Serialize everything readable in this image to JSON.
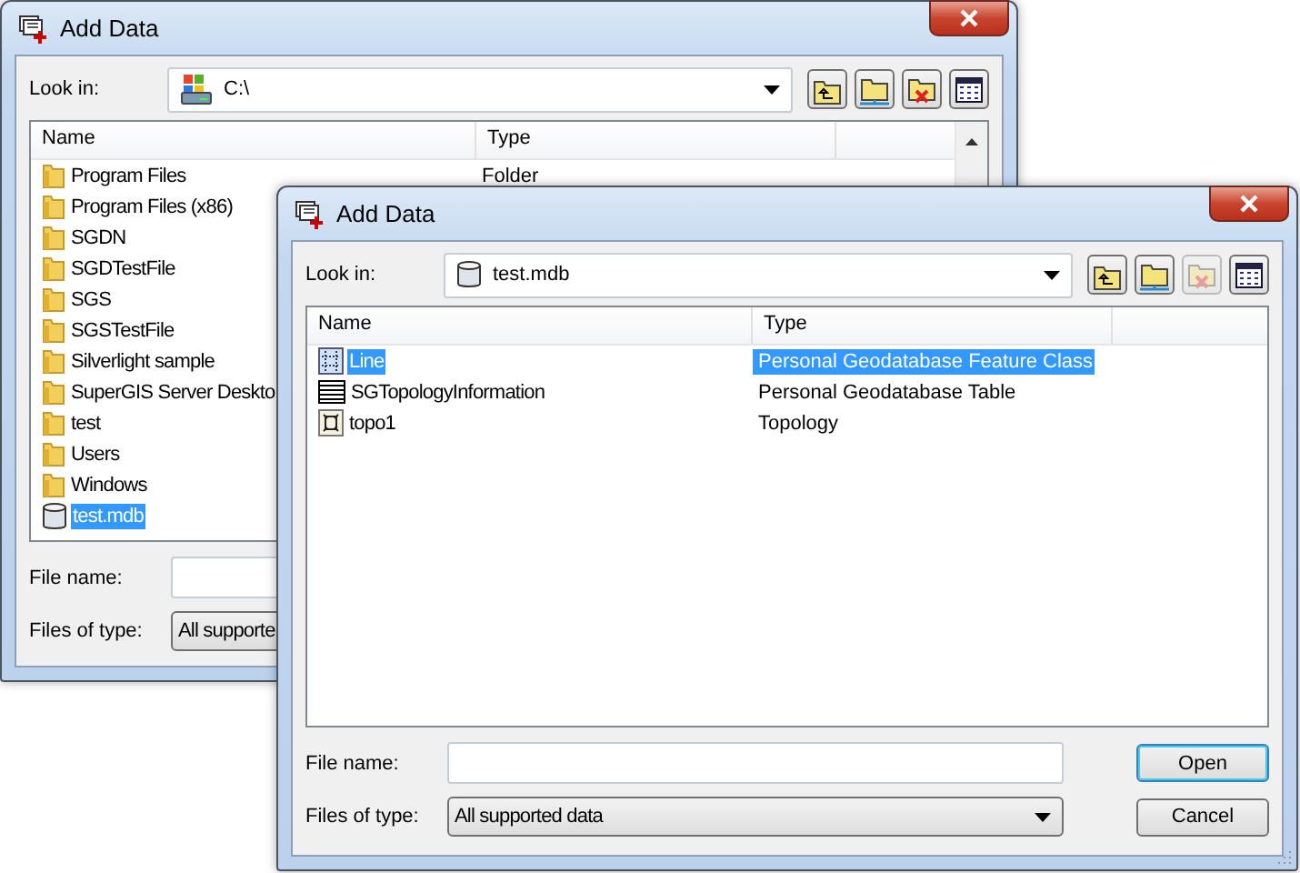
{
  "windows": [
    {
      "title": "Add Data",
      "look_in": {
        "label": "Look in:",
        "value": "C:\\",
        "kind": "drive"
      },
      "toolbar": [
        {
          "kind": "up",
          "disabled": false
        },
        {
          "kind": "connect",
          "disabled": false
        },
        {
          "kind": "disconnect",
          "disabled": false
        },
        {
          "kind": "options",
          "disabled": false
        }
      ],
      "columns": [
        "Name",
        "Type"
      ],
      "rows": [
        {
          "name": "Program Files",
          "type": "Folder",
          "kind": "folder",
          "selected": false
        },
        {
          "name": "Program Files (x86)",
          "kind": "folder",
          "selected": false
        },
        {
          "name": "SGDN",
          "kind": "folder",
          "selected": false
        },
        {
          "name": "SGDTestFile",
          "kind": "folder",
          "selected": false
        },
        {
          "name": "SGS",
          "kind": "folder",
          "selected": false
        },
        {
          "name": "SGSTestFile",
          "kind": "folder",
          "selected": false
        },
        {
          "name": "Silverlight sample",
          "kind": "folder",
          "selected": false
        },
        {
          "name": "SuperGIS Server Deskto",
          "kind": "folder",
          "selected": false
        },
        {
          "name": "test",
          "kind": "folder",
          "selected": false
        },
        {
          "name": "Users",
          "kind": "folder",
          "selected": false
        },
        {
          "name": "Windows",
          "kind": "folder",
          "selected": false
        },
        {
          "name": "test.mdb",
          "kind": "database",
          "selected": true
        }
      ],
      "file_name": {
        "label": "File name:"
      },
      "file_type": {
        "label": "Files of type:",
        "value": "All supporte"
      }
    },
    {
      "title": "Add Data",
      "look_in": {
        "label": "Look in:",
        "value": "test.mdb",
        "kind": "database"
      },
      "toolbar": [
        {
          "kind": "up",
          "disabled": false
        },
        {
          "kind": "connect",
          "disabled": false
        },
        {
          "kind": "disconnect",
          "disabled": true
        },
        {
          "kind": "options",
          "disabled": false
        }
      ],
      "columns": [
        "Name",
        "Type"
      ],
      "rows": [
        {
          "name": "Line",
          "type": "Personal Geodatabase Feature Class",
          "kind": "feature_class",
          "selected": true
        },
        {
          "name": "SGTopologyInformation",
          "type": "Personal Geodatabase Table",
          "kind": "table",
          "selected": false
        },
        {
          "name": "topo1",
          "type": "Topology",
          "kind": "topology",
          "selected": false
        }
      ],
      "file_name": {
        "label": "File name:"
      },
      "file_type": {
        "label": "Files of type:",
        "value": "All supported data"
      },
      "buttons": [
        {
          "label": "Open",
          "default": true
        },
        {
          "label": "Cancel",
          "default": false
        }
      ]
    }
  ]
}
